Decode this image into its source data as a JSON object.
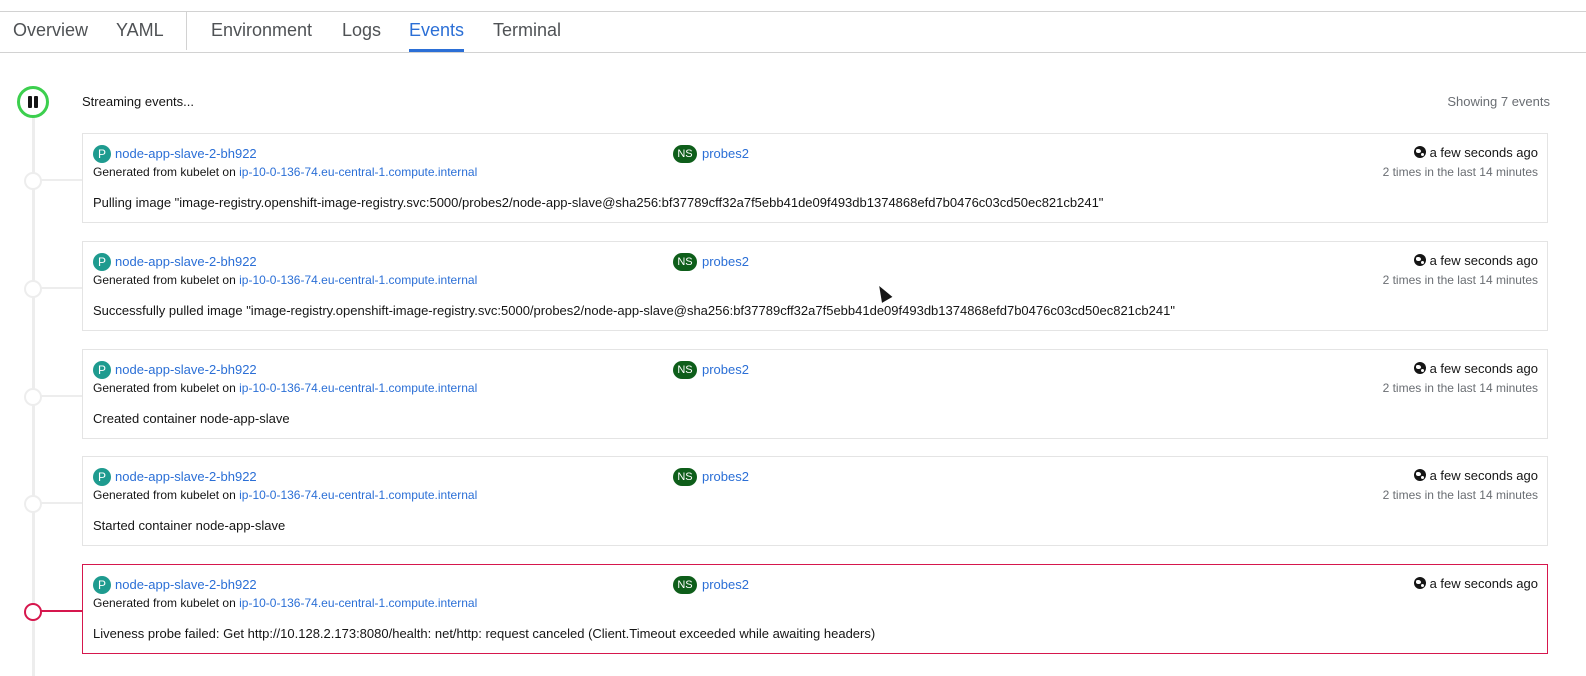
{
  "tabs": [
    {
      "label": "Overview",
      "active": false
    },
    {
      "label": "YAML",
      "active": false
    },
    {
      "label": "Environment",
      "active": false
    },
    {
      "label": "Logs",
      "active": false
    },
    {
      "label": "Events",
      "active": true
    },
    {
      "label": "Terminal",
      "active": false
    }
  ],
  "stream": {
    "status_text": "Streaming events...",
    "showing_text": "Showing 7 events",
    "pause_icon": "pause-icon",
    "status_color": "#3ccf4e"
  },
  "colors": {
    "link": "#2b6fd6",
    "pod_badge": "#1e9b8f",
    "ns_badge": "#0e5e1a",
    "warning": "#d6174d"
  },
  "events": [
    {
      "pod_badge": "P",
      "pod_name": "node-app-slave-2-bh922",
      "ns_badge": "NS",
      "namespace": "probes2",
      "generated_prefix": "Generated from kubelet on",
      "node": "ip-10-0-136-74.eu-central-1.compute.internal",
      "time": "a few seconds ago",
      "count": "2 times in the last 14 minutes",
      "message": "Pulling image \"image-registry.openshift-image-registry.svc:5000/probes2/node-app-slave@sha256:bf37789cff32a7f5ebb41de09f493db1374868efd7b0476c03cd50ec821cb241\"",
      "warning": false
    },
    {
      "pod_badge": "P",
      "pod_name": "node-app-slave-2-bh922",
      "ns_badge": "NS",
      "namespace": "probes2",
      "generated_prefix": "Generated from kubelet on",
      "node": "ip-10-0-136-74.eu-central-1.compute.internal",
      "time": "a few seconds ago",
      "count": "2 times in the last 14 minutes",
      "message": "Successfully pulled image \"image-registry.openshift-image-registry.svc:5000/probes2/node-app-slave@sha256:bf37789cff32a7f5ebb41de09f493db1374868efd7b0476c03cd50ec821cb241\"",
      "warning": false
    },
    {
      "pod_badge": "P",
      "pod_name": "node-app-slave-2-bh922",
      "ns_badge": "NS",
      "namespace": "probes2",
      "generated_prefix": "Generated from kubelet on",
      "node": "ip-10-0-136-74.eu-central-1.compute.internal",
      "time": "a few seconds ago",
      "count": "2 times in the last 14 minutes",
      "message": "Created container node-app-slave",
      "warning": false
    },
    {
      "pod_badge": "P",
      "pod_name": "node-app-slave-2-bh922",
      "ns_badge": "NS",
      "namespace": "probes2",
      "generated_prefix": "Generated from kubelet on",
      "node": "ip-10-0-136-74.eu-central-1.compute.internal",
      "time": "a few seconds ago",
      "count": "2 times in the last 14 minutes",
      "message": "Started container node-app-slave",
      "warning": false
    },
    {
      "pod_badge": "P",
      "pod_name": "node-app-slave-2-bh922",
      "ns_badge": "NS",
      "namespace": "probes2",
      "generated_prefix": "Generated from kubelet on",
      "node": "ip-10-0-136-74.eu-central-1.compute.internal",
      "time": "a few seconds ago",
      "count": "",
      "message": "Liveness probe failed: Get http://10.128.2.173:8080/health: net/http: request canceled (Client.Timeout exceeded while awaiting headers)",
      "warning": true
    }
  ]
}
